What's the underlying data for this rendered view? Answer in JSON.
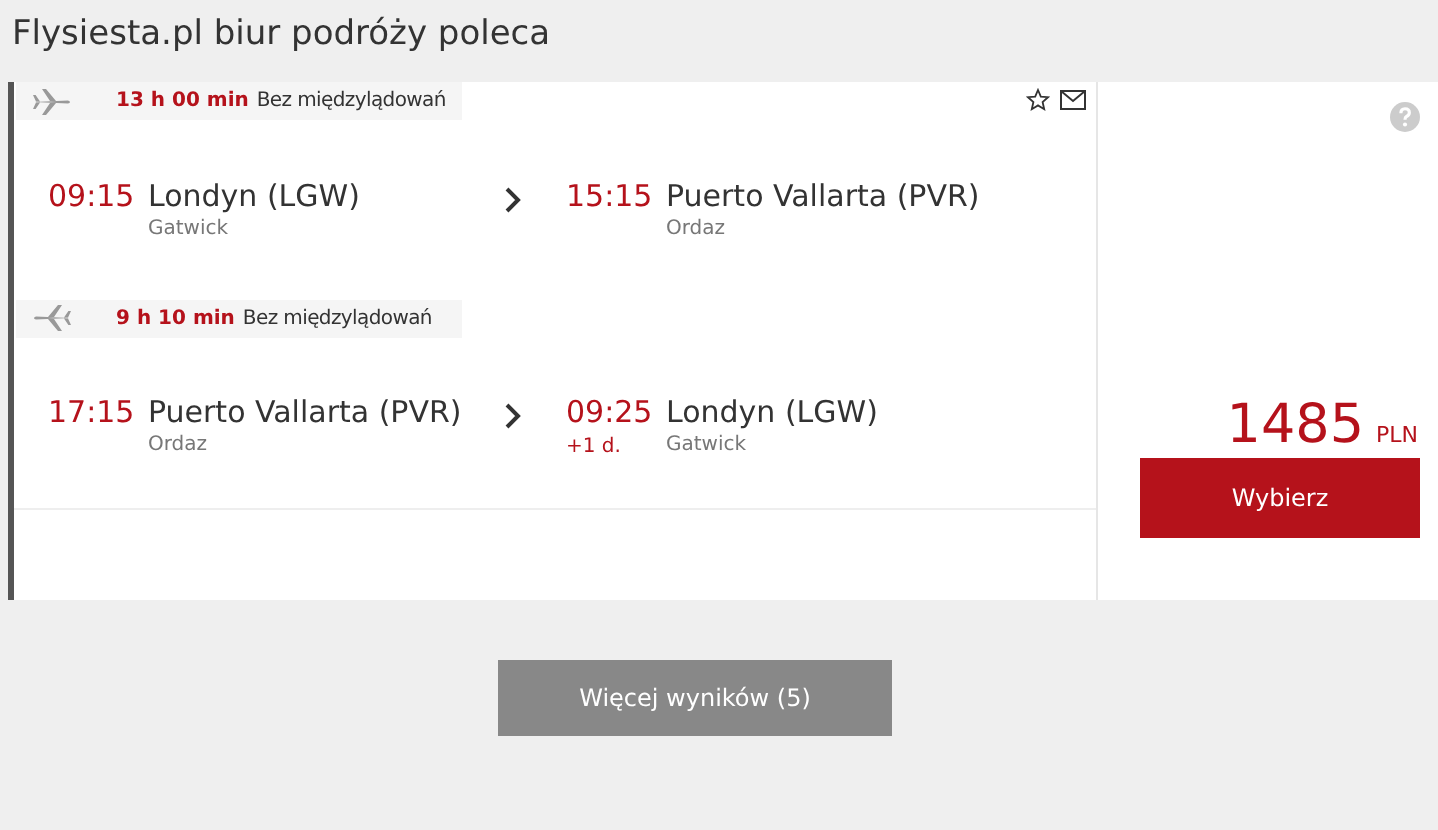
{
  "header": {
    "title": "Flysiesta.pl biur podróży poleca"
  },
  "legs": [
    {
      "kind": "outbound",
      "duration": "13 h 00 min",
      "stops": "Bez międzylądowań",
      "depart_time": "09:15",
      "from": "Londyn (LGW)",
      "from_airport": "Gatwick",
      "arrive_time": "15:15",
      "to": "Puerto Vallarta (PVR)",
      "to_airport": "Ordaz"
    },
    {
      "kind": "return",
      "duration": "9 h 10 min",
      "stops": "Bez międzylądowań",
      "depart_time": "17:15",
      "from": "Puerto Vallarta (PVR)",
      "from_airport": "Ordaz",
      "arrive_time": "09:25",
      "day_offset": "+1 d.",
      "to": "Londyn (LGW)",
      "to_airport": "Gatwick"
    }
  ],
  "price": {
    "amount": "1485",
    "currency": "PLN",
    "button": "Wybierz"
  },
  "more_button": "Więcej wyników (5)"
}
